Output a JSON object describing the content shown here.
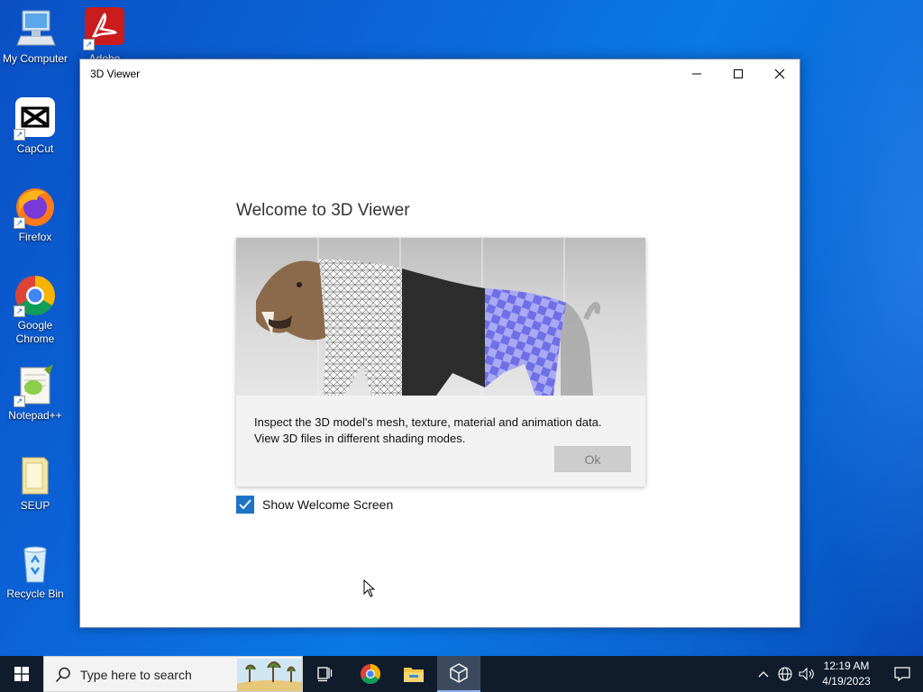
{
  "desktop": {
    "icons": [
      {
        "label": "My Computer"
      },
      {
        "label": "Adobe"
      },
      {
        "label": "CapCut"
      },
      {
        "label": "Firefox"
      },
      {
        "label": "Google Chrome"
      },
      {
        "label": "Notepad++"
      },
      {
        "label": "SEUP"
      },
      {
        "label": "Recycle Bin"
      }
    ]
  },
  "window": {
    "title": "3D Viewer",
    "controls": {
      "minimize": "minimize-icon",
      "maximize": "maximize-icon",
      "close": "close-icon"
    },
    "welcome_title": "Welcome to 3D Viewer",
    "description_line1": "Inspect the 3D model's mesh, texture, material and animation data.",
    "description_line2": "View 3D files in different shading modes.",
    "ok_label": "Ok",
    "show_welcome_label": "Show Welcome Screen",
    "show_welcome_checked": true
  },
  "taskbar": {
    "search_placeholder": "Type here to search",
    "pinned": [
      "task-view-icon",
      "chrome-icon",
      "file-explorer-icon",
      "3d-viewer-icon"
    ],
    "tray_icons": [
      "chevron-up-icon",
      "network-icon",
      "volume-icon"
    ],
    "time": "12:19 AM",
    "date": "4/19/2023"
  },
  "colors": {
    "accent": "#1f73c4",
    "taskbar": "#101b2b",
    "desktop": "#0a64d2"
  }
}
